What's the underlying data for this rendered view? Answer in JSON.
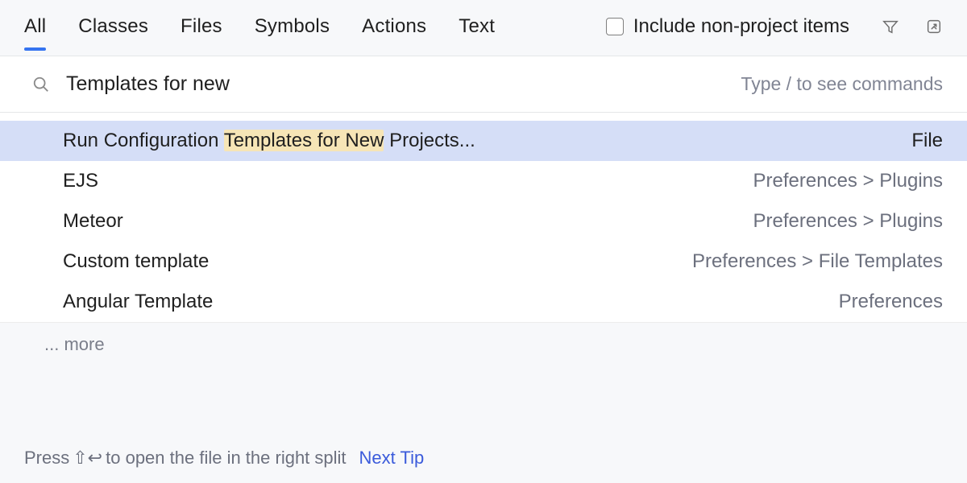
{
  "tabs": [
    {
      "label": "All",
      "active": true
    },
    {
      "label": "Classes",
      "active": false
    },
    {
      "label": "Files",
      "active": false
    },
    {
      "label": "Symbols",
      "active": false
    },
    {
      "label": "Actions",
      "active": false
    },
    {
      "label": "Text",
      "active": false
    }
  ],
  "include": {
    "label": "Include non-project items",
    "checked": false
  },
  "search": {
    "value": "Templates for new",
    "hint": "Type / to see commands"
  },
  "results": [
    {
      "left_pre": "Run Configuration ",
      "left_match": "Templates for New",
      "left_post": " Projects...",
      "right": "File",
      "selected": true
    },
    {
      "left_pre": "EJS",
      "left_match": "",
      "left_post": "",
      "right": "Preferences > Plugins",
      "selected": false
    },
    {
      "left_pre": "Meteor",
      "left_match": "",
      "left_post": "",
      "right": "Preferences > Plugins",
      "selected": false
    },
    {
      "left_pre": "Custom template",
      "left_match": "",
      "left_post": "",
      "right": "Preferences > File Templates",
      "selected": false
    },
    {
      "left_pre": "Angular Template",
      "left_match": "",
      "left_post": "",
      "right": "Preferences",
      "selected": false
    }
  ],
  "more": "... more",
  "footer": {
    "pre": "Press ",
    "shortcut_glyph": "⇧↩",
    "post": " to open the file in the right split",
    "next_tip": "Next Tip"
  }
}
